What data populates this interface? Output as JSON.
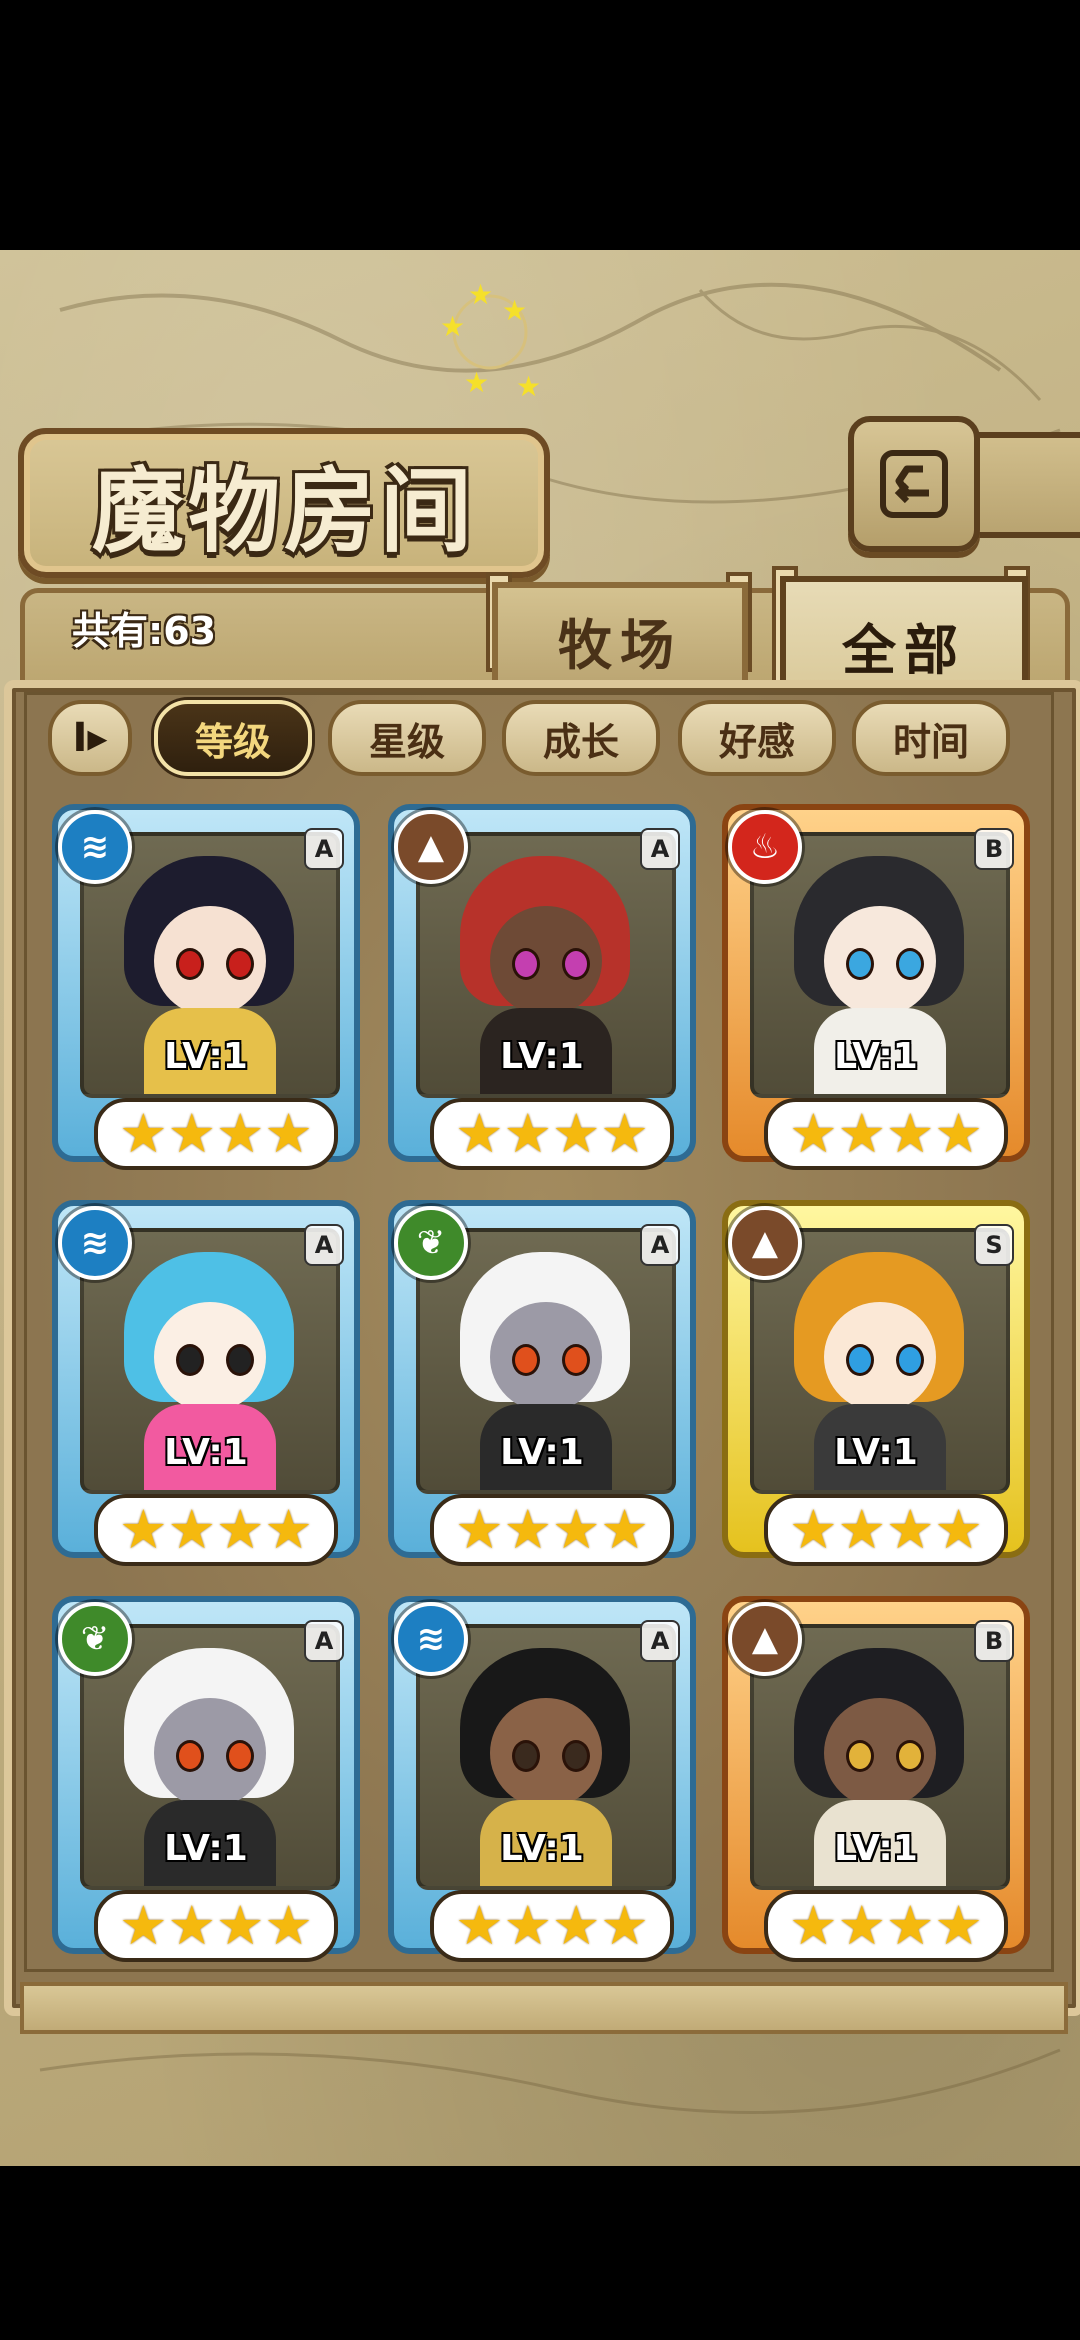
{
  "title": "魔物房间",
  "count_label": "共有:63",
  "tabs": {
    "ranch": "牧场",
    "all": "全部"
  },
  "sort_toggle": "I▸",
  "sort_pills": [
    "等级",
    "星级",
    "成长",
    "好感",
    "时间"
  ],
  "active_sort": "等级",
  "colors": {
    "water": "#1d7fc2",
    "earth": "#7a4a2a",
    "fire": "#d3261c",
    "grass": "#3f8a2a"
  },
  "monsters": [
    {
      "element": "water-icon",
      "rank": "A",
      "level": "LV:1",
      "stars": "★★★★",
      "frame": "blue"
    },
    {
      "element": "earth-icon",
      "rank": "A",
      "level": "LV:1",
      "stars": "★★★★",
      "frame": "blue"
    },
    {
      "element": "fire-icon",
      "rank": "B",
      "level": "LV:1",
      "stars": "★★★★",
      "frame": "orange"
    },
    {
      "element": "water-icon",
      "rank": "A",
      "level": "LV:1",
      "stars": "★★★★",
      "frame": "blue"
    },
    {
      "element": "grass-icon",
      "rank": "A",
      "level": "LV:1",
      "stars": "★★★★",
      "frame": "blue"
    },
    {
      "element": "earth-icon",
      "rank": "S",
      "level": "LV:1",
      "stars": "★★★★",
      "frame": "gold"
    },
    {
      "element": "grass-icon",
      "rank": "A",
      "level": "LV:1",
      "stars": "★★★★",
      "frame": "blue"
    },
    {
      "element": "water-icon",
      "rank": "A",
      "level": "LV:1",
      "stars": "★★★★",
      "frame": "blue"
    },
    {
      "element": "earth-icon",
      "rank": "B",
      "level": "LV:1",
      "stars": "★★★★",
      "frame": "orange"
    }
  ]
}
